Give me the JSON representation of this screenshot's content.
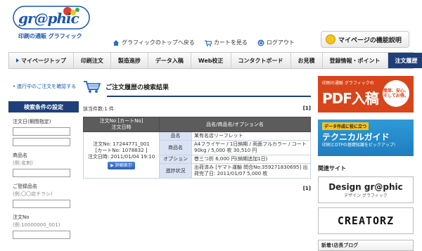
{
  "brand": {
    "logo_word": "gr@phic",
    "logo_sub": "印刷の通販 グラフィック"
  },
  "header_links": {
    "top": "グラフィックのトップへ戻る",
    "cart": "カートを見る",
    "logout": "ログアウト"
  },
  "mypage_help": "マイページの機能説明",
  "nav": [
    {
      "label": "マイページトップ"
    },
    {
      "label": "印刷注文"
    },
    {
      "label": "製造進捗"
    },
    {
      "label": "データ入稿"
    },
    {
      "label": "Web校正"
    },
    {
      "label": "コンタクトボード"
    },
    {
      "label": "お見積"
    },
    {
      "label": "登録情報・ポイント"
    },
    {
      "label": "注文履歴"
    }
  ],
  "sidebar": {
    "link": "進行中のご注文を確認する",
    "header": "検索条件の設定",
    "fields": [
      {
        "label": "注文日(期間指定)",
        "hint": ""
      },
      {
        "label": "商品名",
        "hint": "(例:名刺)"
      },
      {
        "label": "ご登録品名",
        "hint": "(例:〇〇店チラシ)"
      },
      {
        "label": "注文No",
        "hint": "(例:10000000_001)"
      }
    ]
  },
  "main": {
    "title": "ご注文履歴の検索結果",
    "count": "該当件数:1 件",
    "pager": "[1]",
    "table": {
      "col1": "注文No [カートNo]",
      "col1b": "注文日時",
      "col2": "品名/商品名/オプション名",
      "order_no": "注文No: 17244771_001",
      "cart_no": "[カートNo: 1078832 ]",
      "order_date": "注文日時: 2011/01/04 19:10",
      "detail_button": "詳細表示",
      "rows": [
        {
          "label": "品名",
          "value": "某有名店リーフレット"
        },
        {
          "label": "商品名",
          "value": "A4フライヤー / 1日納期 / 両面フルカラー / コート90kg / 5,000 枚 30,510 円"
        },
        {
          "label": "オプション",
          "value": "巻三つ折   6,000 円(納期追加1日)"
        },
        {
          "label": "進捗状況",
          "value": "出荷済み [ヤマト運輸 問合No:359271830695] 出荷完了日: 2011/01/07 5,000 枚"
        }
      ]
    }
  },
  "right": {
    "pdf_small": "印刷の通販 グラフィックの",
    "pdf_big": "PDF入稿",
    "pdf_badge": "簡単、安心、そしてお得。",
    "tech_ribbon": "データ作成に役に立つ",
    "tech_big": "テクニカルガイド",
    "tech_small": "印刷とDTPの基礎知識をピックアップ!",
    "related": "関連サイト",
    "site1": "Design gr@phic",
    "site1_sub": "デザイン グラフィック",
    "site2": "CREATORZ",
    "blog": "新着!店長ブログ"
  },
  "colors": {
    "nav_active": "#1f3f7a",
    "link": "#1a56b0",
    "pdf_banner": "#d8451a",
    "tech_banner": "#1f7dbf"
  }
}
